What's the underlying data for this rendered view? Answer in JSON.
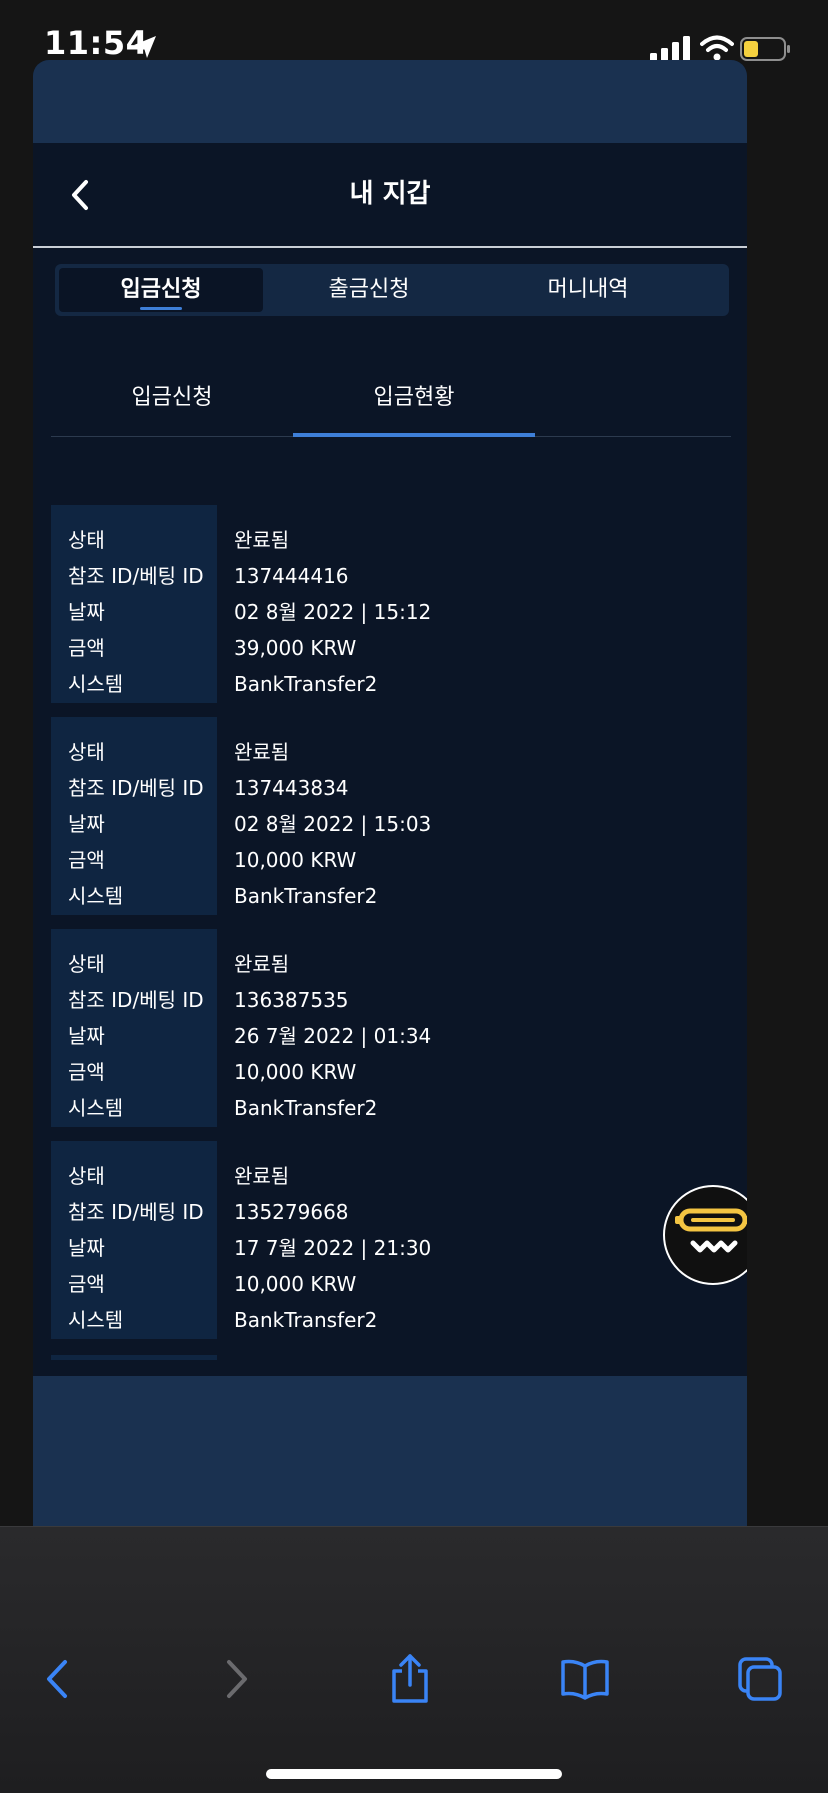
{
  "status_bar": {
    "time": "11:54",
    "icons": [
      "location-arrow-icon",
      "signal-bars-icon",
      "wifi-icon",
      "battery-icon"
    ]
  },
  "header": {
    "title": "내 지갑",
    "back_icon": "chevron-left-icon"
  },
  "main_tabs": [
    {
      "label": "입금신청",
      "active": true
    },
    {
      "label": "출금신청",
      "active": false
    },
    {
      "label": "머니내역",
      "active": false
    }
  ],
  "sub_tabs": [
    {
      "label": "입금신청",
      "active": false
    },
    {
      "label": "입금현황",
      "active": true
    }
  ],
  "field_labels": {
    "status": "상태",
    "ref_id": "참조 ID/베팅 ID",
    "date": "날짜",
    "amount": "금액",
    "system": "시스템"
  },
  "records": [
    {
      "status": "완료됨",
      "ref_id": "137444416",
      "date": "02 8월 2022 | 15:12",
      "amount": "39,000 KRW",
      "system": "BankTransfer2"
    },
    {
      "status": "완료됨",
      "ref_id": "137443834",
      "date": "02 8월 2022 | 15:03",
      "amount": "10,000 KRW",
      "system": "BankTransfer2"
    },
    {
      "status": "완료됨",
      "ref_id": "136387535",
      "date": "26 7월 2022 | 01:34",
      "amount": "10,000 KRW",
      "system": "BankTransfer2"
    },
    {
      "status": "완료됨",
      "ref_id": "135279668",
      "date": "17 7월 2022 | 21:30",
      "amount": "10,000 KRW",
      "system": "BankTransfer2"
    }
  ],
  "fab": {
    "icon": "chat-support-icon"
  },
  "browser_toolbar": {
    "icons": [
      "back-arrow-icon",
      "forward-arrow-icon",
      "share-icon",
      "bookmarks-icon",
      "tabs-icon"
    ]
  },
  "colors": {
    "page_bg": "#0b1526",
    "band": "#1a3150",
    "accent": "#3e7fd8",
    "label_cell": "#0f2541",
    "fab_yellow": "#f4c542"
  }
}
